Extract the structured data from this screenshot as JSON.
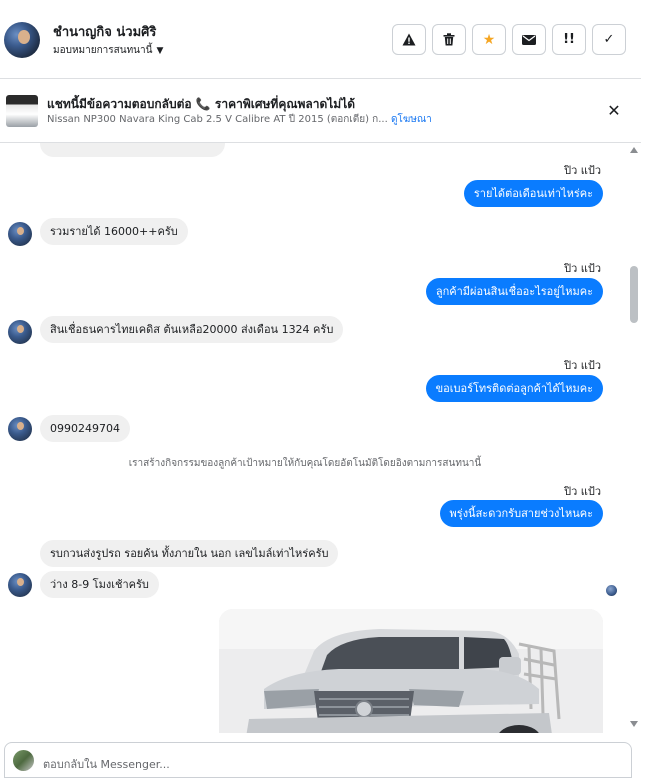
{
  "header": {
    "contact_name": "ชำนาญกิจ น่วมศิริ",
    "assign_label": "มอบหมายการสนทนานี้",
    "actions": [
      {
        "icon": "warning-icon",
        "glyph": "▲"
      },
      {
        "icon": "trash-icon",
        "glyph": "🗑"
      },
      {
        "icon": "star-icon",
        "glyph": "★"
      },
      {
        "icon": "envelope-icon",
        "glyph": "✉"
      },
      {
        "icon": "follow-up-icon",
        "glyph": "!!"
      },
      {
        "icon": "check-icon",
        "glyph": "✓"
      }
    ]
  },
  "ad": {
    "title_prefix": "แชทนี้มีข้อความตอบกลับต่อ",
    "phone_glyph": "📞",
    "title_suffix": "ราคาพิเศษที่คุณพลาดไม่ได้",
    "subtitle": "Nissan NP300 Navara King Cab 2.5 V Calibre AT ปี 2015 (ตอกเตีย) ก...",
    "view_ad_link": "ดูโฆษณา"
  },
  "messages": {
    "sender_1": "ปิว แป้ว",
    "out_1": "รายได้ต่อเดือนเท่าไหร่คะ",
    "in_1": "รวมรายได้ 16000++ครับ",
    "sender_2": "ปิว แป้ว",
    "out_2": "ลูกค้ามีผ่อนสินเชื่ออะไรอยู่ไหมคะ",
    "in_2": "สินเชื่อธนคารไทยเคดิส  ต้นเหลือ20000 ส่งเดือน 1324 ครับ",
    "sender_3": "ปิว แป้ว",
    "out_3": "ขอเบอร์โทรติดต่อลูกค้าได้ไหมคะ",
    "in_3": "0990249704",
    "system_note": "เราสร้างกิจกรรมของลูกค้าเป้าหมายให้กับคุณโดยอัตโนมัติโดยอิงตามการสนทนานี้",
    "sender_4": "ปิว แป้ว",
    "out_4": "พรุ่งนี้สะดวกรับสายช่วงไหนคะ",
    "in_4a": "รบกวนส่งรูปรถ รอยค้น ทั้งภายใน นอก เลขไมล์เท่าไหร่ครับ",
    "in_4b": "ว่าง 8-9 โมงเช้าครับ"
  },
  "car_image": {
    "brand": "NISSAN"
  },
  "composer": {
    "placeholder": "ตอบกลับใน Messenger..."
  }
}
